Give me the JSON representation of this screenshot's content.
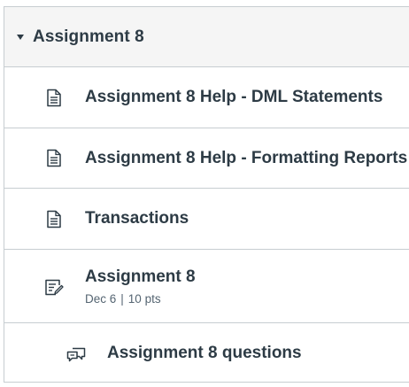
{
  "module": {
    "title": "Assignment 8",
    "items": [
      {
        "title": "Assignment 8 Help - DML Statements",
        "icon": "page-icon"
      },
      {
        "title": "Assignment 8 Help - Formatting Reports",
        "icon": "page-icon"
      },
      {
        "title": "Transactions",
        "icon": "page-icon"
      },
      {
        "title": "Assignment 8",
        "icon": "assignment-icon",
        "due": "Dec 6",
        "separator": "|",
        "points": "10 pts"
      },
      {
        "title": "Assignment 8 questions",
        "icon": "discussion-icon"
      }
    ]
  },
  "colors": {
    "text": "#2d3b45",
    "meta_text": "#556572",
    "border": "#c7cdd1",
    "header_bg": "#f5f5f5"
  }
}
